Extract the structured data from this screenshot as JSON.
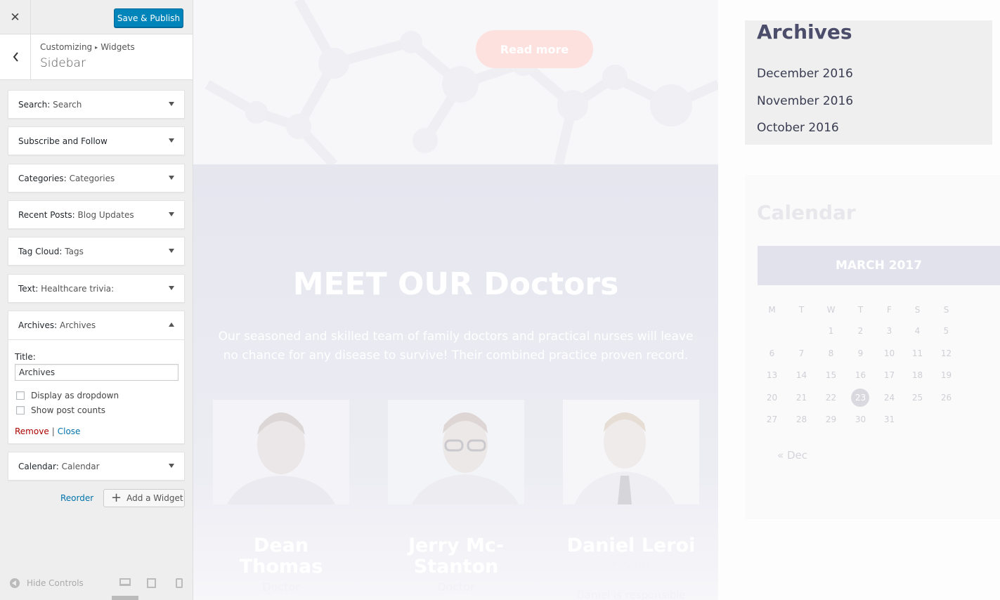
{
  "panel": {
    "save_label": "Save & Publish",
    "breadcrumb": {
      "root": "Customizing",
      "child": "Widgets"
    },
    "section_title": "Sidebar",
    "widgets": [
      {
        "type": "Search:",
        "title": "Search"
      },
      {
        "type": "Subscribe and Follow",
        "title": ""
      },
      {
        "type": "Categories:",
        "title": "Categories"
      },
      {
        "type": "Recent Posts:",
        "title": "Blog Updates"
      },
      {
        "type": "Tag Cloud:",
        "title": "Tags"
      },
      {
        "type": "Text:",
        "title": "Healthcare trivia:"
      },
      {
        "type": "Archives:",
        "title": "Archives"
      },
      {
        "type": "Calendar:",
        "title": "Calendar"
      }
    ],
    "archives_form": {
      "title_label": "Title:",
      "title_value": "Archives",
      "dropdown_label": "Display as dropdown",
      "dropdown_checked": false,
      "counts_label": "Show post counts",
      "counts_checked": false,
      "remove_label": "Remove",
      "separator": "|",
      "close_label": "Close"
    },
    "reorder_label": "Reorder",
    "add_widget_label": "Add a Widget",
    "hide_controls_label": "Hide Controls"
  },
  "preview": {
    "read_more": "Read more",
    "doctors_title": "MEET OUR Doctors",
    "doctors_desc": "Our seasoned and skilled team of family doctors and practical nurses will leave no chance for any disease to survive! Their combined practice proven record.",
    "doctors": [
      {
        "name": "Dean Thomas",
        "role": "Doctor",
        "bio": ""
      },
      {
        "name": "Jerry Mc-Stanton",
        "role": "Doctor",
        "bio": ""
      },
      {
        "name": "Daniel Leroi",
        "role": "Doctor",
        "bio": "Daniel is responsible"
      }
    ],
    "archives": {
      "title": "Archives",
      "items": [
        "December 2016",
        "November 2016",
        "October 2016"
      ]
    },
    "calendar": {
      "title": "Calendar",
      "month": "MARCH 2017",
      "weekdays": [
        "M",
        "T",
        "W",
        "T",
        "F",
        "S",
        "S"
      ],
      "weeks": [
        [
          "",
          "",
          "1",
          "2",
          "3",
          "4",
          "5"
        ],
        [
          "6",
          "7",
          "8",
          "9",
          "10",
          "11",
          "12"
        ],
        [
          "13",
          "14",
          "15",
          "16",
          "17",
          "18",
          "19"
        ],
        [
          "20",
          "21",
          "22",
          "23",
          "24",
          "25",
          "26"
        ],
        [
          "27",
          "28",
          "29",
          "30",
          "31",
          "",
          ""
        ]
      ],
      "today": "23",
      "prev_link": "« Dec"
    }
  }
}
